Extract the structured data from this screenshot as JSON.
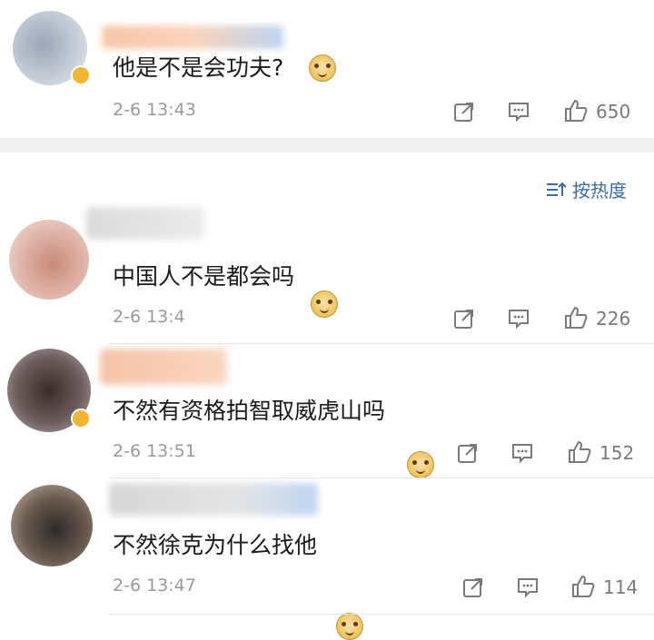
{
  "sort": {
    "label": "按热度"
  },
  "comments": [
    {
      "text": "他是不是会功夫?",
      "time": "2-6 13:43",
      "likes": "650"
    },
    {
      "text": "中国人不是都会吗",
      "time": "2-6 13:4",
      "likes": "226"
    },
    {
      "text": "不然有资格拍智取威虎山吗",
      "time": "2-6 13:51",
      "likes": "152"
    },
    {
      "text": "不然徐克为什么找他",
      "time": "2-6 13:47",
      "likes": "114"
    }
  ],
  "icons": {
    "share": "share-icon",
    "reply": "comment-icon",
    "like": "thumbs-up-icon",
    "emoji": "doge-emoji-icon",
    "sort": "sort-icon",
    "verified": "verified-badge-icon"
  },
  "colors": {
    "link": "#3b6ea5",
    "meta": "#9a9a9a",
    "band": "#f1f1f1"
  }
}
